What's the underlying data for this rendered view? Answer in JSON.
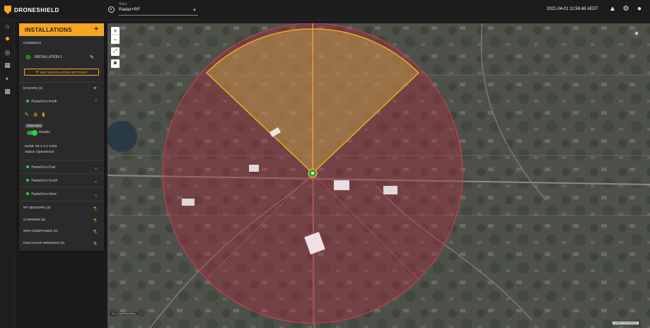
{
  "topbar": {
    "brand": "DRONESHIELD",
    "site_label": "Sites",
    "site_value": "Radar+RF",
    "datetime": "2021-04-01 11:56:48 AEDT"
  },
  "rail": {
    "icons": [
      "home-icon",
      "settings-icon",
      "target-icon",
      "map-icon",
      "chart-icon",
      "grid-icon"
    ],
    "active": "settings-icon"
  },
  "panel": {
    "title": "INSTALLATIONS",
    "installations_label": "Installations",
    "installation_name": "INSTALLATION 1",
    "edit_button": "EDIT INSTALLATION SETTINGS",
    "radars_label": "RADARS (4)",
    "radar_north": "RadarZero-North",
    "radar_mask_tooltip": "Radar Mask",
    "disable_label": "Disable",
    "serial": "Serial: 59-1-1-1-1234",
    "status": "Status: Operational",
    "radar_east": "RadarZero-East",
    "radar_south": "RadarZero-South",
    "radar_west": "RadarZero-West",
    "rf_sensors": "RF SENSORS (3)",
    "cannons": "CANNONS (5)",
    "gps_compasses": "GPS COMPASSES (0)",
    "discovair_sensors": "DISCOVAIR SENSORS (0)"
  },
  "map": {
    "zoom_in": "+",
    "zoom_out": "−",
    "attribution_left": "Esri | OpenStreetMap",
    "attribution_right": "Leaflet | DroneShield"
  },
  "colors": {
    "accent": "#f5a623",
    "status_green": "#33cc33",
    "coverage_red": "#c0304a",
    "mask_yellow": "#d8c060"
  }
}
